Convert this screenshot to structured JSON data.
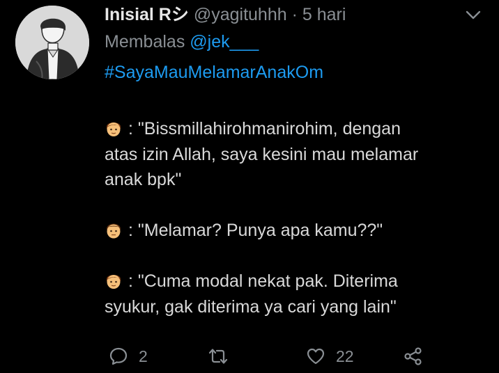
{
  "tweet": {
    "display_name": "Inisial Rシ",
    "handle": "@yagituhhh",
    "separator": "·",
    "time": "5 hari",
    "reply_prefix": "Membalas",
    "reply_to": "@jek___",
    "hashtag": "#SayaMauMelamarAnakOm",
    "paragraphs": [
      {
        "speaker_icon": "boy-emoji-icon",
        "lines": [
          ": \"Bissmillahirohmanirohim, dengan",
          "atas izin Allah, saya kesini mau melamar",
          "anak bpk\""
        ]
      },
      {
        "speaker_icon": "man-emoji-icon",
        "lines": [
          ": \"Melamar? Punya apa kamu??\""
        ]
      },
      {
        "speaker_icon": "boy-emoji-icon",
        "lines": [
          ": \"Cuma modal nekat pak. Diterima",
          "syukur, gak diterima ya cari yang lain\""
        ]
      }
    ]
  },
  "actions": {
    "reply_icon": "reply-bubble-icon",
    "reply_count": "2",
    "retweet_icon": "retweet-icon",
    "like_icon": "heart-icon",
    "like_count": "22",
    "share_icon": "share-icon"
  },
  "colors": {
    "background": "#000000",
    "text": "#d9d9d9",
    "muted": "#8a8f94",
    "link": "#1d9bf0"
  }
}
